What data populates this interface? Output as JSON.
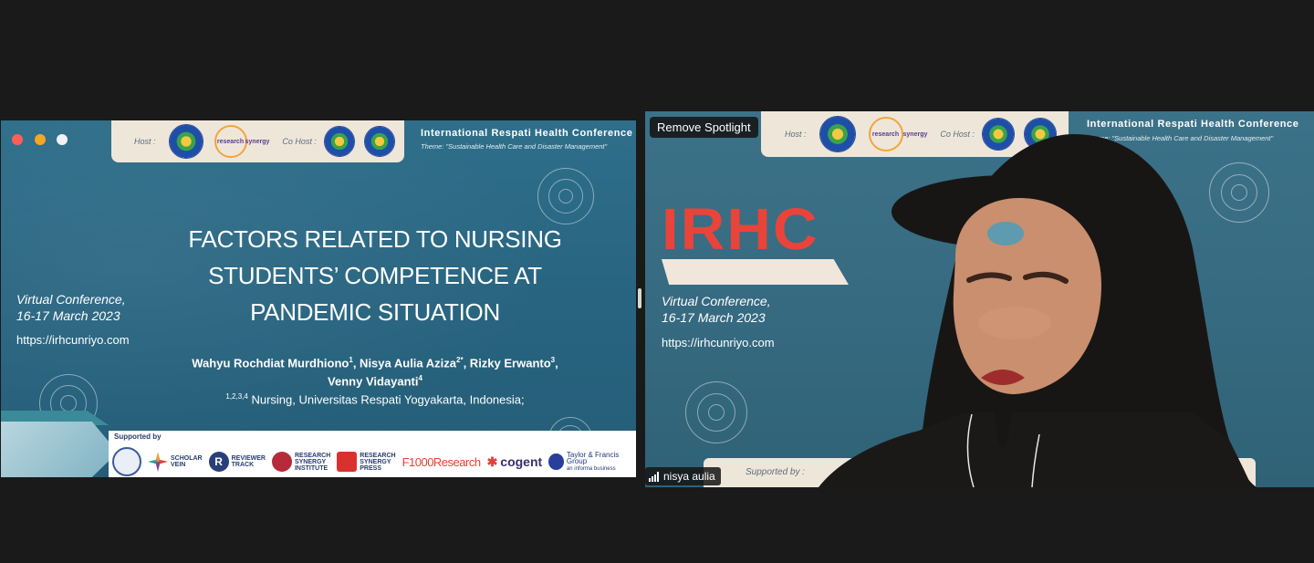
{
  "left_slide": {
    "banner": {
      "host_label": "Host :",
      "research_logo_text": "research",
      "synergy_text": "synergy",
      "cohost_label": "Co Host :"
    },
    "conference_title": "International  Respati Health Conference",
    "theme": "Theme: \"Sustainable Health Care and Disaster Management\"",
    "title_lines": [
      "FACTORS RELATED TO NURSING",
      "STUDENTS’ COMPETENCE AT",
      "PANDEMIC SITUATION"
    ],
    "authors": {
      "a1": "Wahyu Rochdiat Murdhiono",
      "a1_sup": "1",
      "a2": ", Nisya Aulia Aziza",
      "a2_sup": "2*",
      "a3": ", Rizky Erwanto",
      "a3_sup": "3",
      "a3_tail": ",",
      "a4": "Venny Vidayanti",
      "a4_sup": "4"
    },
    "affiliation_sup": "1,2,3,4",
    "affiliation": " Nursing, Universitas Respati Yogyakarta, Indonesia;",
    "virtual_line1": "Virtual Conference,",
    "virtual_line2": "16-17 March 2023",
    "url": "https://irhcunriyo.com",
    "supported_by": "Supported by",
    "sponsors": {
      "scholar": "SCHOLAR",
      "vein": "VEIN",
      "reviewer": "REVIEWER",
      "track": "TRACK",
      "rsi1": "RESEARCH",
      "rsi2": "SYNERGY",
      "rsi3": "INSTITUTE",
      "rsp1": "RESEARCH",
      "rsp2": "SYNERGY",
      "rsp3": "PRESS",
      "f1000": "F1000Research",
      "cogent": "cogent",
      "tf": "Taylor & Francis Group",
      "tf_sub": "an informa business"
    }
  },
  "right_video": {
    "remove_spotlight_label": "Remove Spotlight",
    "participant_name": "nisya aulia",
    "banner": {
      "host_label": "Host :",
      "cohost_label": "Co Host :",
      "research_logo_text": "research",
      "synergy_text": "synergy"
    },
    "conference_title": "International  Respati Health Conference",
    "theme": "Theme: \"Sustainable Health Care and Disaster Management\"",
    "logo_text": "IRHC",
    "virtual_line1": "Virtual Conference,",
    "virtual_line2": "16-17 March 2023",
    "url": "https://irhcunriyo.com",
    "supported_by": "Supported by :"
  },
  "colors": {
    "slide_bg": "#286581",
    "banner_bg": "#efe6da",
    "irhc_red": "#e8443a",
    "dot_red": "#ff5f57",
    "dot_orange": "#f5a623",
    "dot_white": "#f2f2f2"
  }
}
